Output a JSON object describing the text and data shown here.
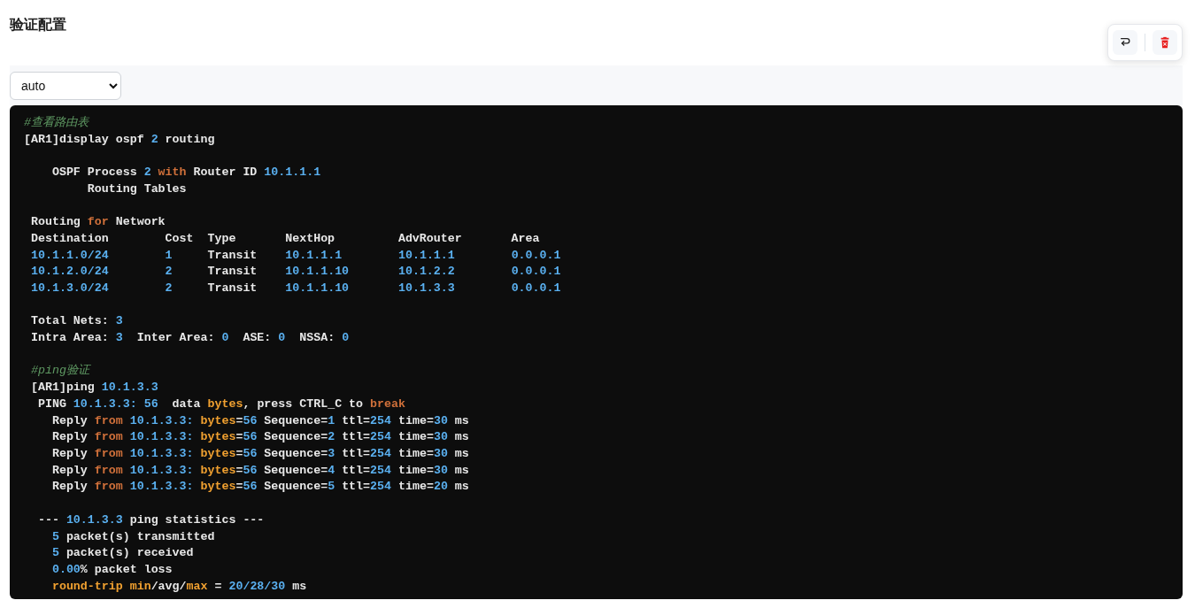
{
  "title": "验证配置",
  "toolbar": {
    "buttons": [
      {
        "kind": "wrap"
      },
      {
        "kind": "delete"
      }
    ]
  },
  "language_select": {
    "value": "auto"
  },
  "code_lines": [
    {
      "tokens": [
        {
          "text": "#查看路由表",
          "kind": "comment"
        }
      ]
    },
    {
      "tokens": [
        {
          "text": "[AR1]display ospf",
          "kind": "text"
        },
        {
          "text": " 2",
          "kind": "num"
        },
        {
          "text": " routing",
          "kind": "text"
        }
      ]
    },
    {
      "kind": "blank"
    },
    {
      "tokens": [
        {
          "text": "    OSPF Process",
          "kind": "text"
        },
        {
          "text": " 2",
          "kind": "num"
        },
        {
          "text": " with",
          "kind": "kw"
        },
        {
          "text": " Router ID",
          "kind": "text"
        },
        {
          "text": " 10.1.1.1",
          "kind": "num"
        }
      ]
    },
    {
      "tokens": [
        {
          "text": "         Routing Tables",
          "kind": "text"
        }
      ]
    },
    {
      "kind": "blank"
    },
    {
      "tokens": [
        {
          "text": " Routing",
          "kind": "text"
        },
        {
          "text": " for",
          "kind": "kw"
        },
        {
          "text": " Network",
          "kind": "text"
        }
      ]
    },
    {
      "tokens": [
        {
          "text": " Destination        Cost  Type       NextHop         AdvRouter       Area",
          "kind": "text"
        }
      ]
    },
    {
      "tokens": [
        {
          "text": " 10.1.1.0/24",
          "kind": "num"
        },
        {
          "text": "        1",
          "kind": "num"
        },
        {
          "text": "     Transit",
          "kind": "text"
        },
        {
          "text": "    10.1.1.1",
          "kind": "num"
        },
        {
          "text": "        10.1.1.1",
          "kind": "num"
        },
        {
          "text": "        0.0.0.1",
          "kind": "num"
        }
      ]
    },
    {
      "tokens": [
        {
          "text": " 10.1.2.0/24",
          "kind": "num"
        },
        {
          "text": "        2",
          "kind": "num"
        },
        {
          "text": "     Transit",
          "kind": "text"
        },
        {
          "text": "    10.1.1.10",
          "kind": "num"
        },
        {
          "text": "       10.1.2.2",
          "kind": "num"
        },
        {
          "text": "        0.0.0.1",
          "kind": "num"
        }
      ]
    },
    {
      "tokens": [
        {
          "text": " 10.1.3.0/24",
          "kind": "num"
        },
        {
          "text": "        2",
          "kind": "num"
        },
        {
          "text": "     Transit",
          "kind": "text"
        },
        {
          "text": "    10.1.1.10",
          "kind": "num"
        },
        {
          "text": "       10.1.3.3",
          "kind": "num"
        },
        {
          "text": "        0.0.0.1",
          "kind": "num"
        }
      ]
    },
    {
      "kind": "blank"
    },
    {
      "tokens": [
        {
          "text": " Total Nets:",
          "kind": "text"
        },
        {
          "text": " 3",
          "kind": "num"
        }
      ]
    },
    {
      "tokens": [
        {
          "text": " Intra Area:",
          "kind": "text"
        },
        {
          "text": " 3",
          "kind": "num"
        },
        {
          "text": "  Inter Area:",
          "kind": "text"
        },
        {
          "text": " 0",
          "kind": "num"
        },
        {
          "text": "  ASE:",
          "kind": "text"
        },
        {
          "text": " 0",
          "kind": "num"
        },
        {
          "text": "  NSSA:",
          "kind": "text"
        },
        {
          "text": " 0",
          "kind": "num"
        }
      ]
    },
    {
      "kind": "blank"
    },
    {
      "tokens": [
        {
          "text": " #ping验证",
          "kind": "comment"
        }
      ]
    },
    {
      "tokens": [
        {
          "text": " [AR1]ping",
          "kind": "text"
        },
        {
          "text": " 10.1.3.3",
          "kind": "num"
        }
      ]
    },
    {
      "tokens": [
        {
          "text": "  PING",
          "kind": "text"
        },
        {
          "text": " 10.1.3.3:",
          "kind": "num"
        },
        {
          "text": " 56",
          "kind": "num"
        },
        {
          "text": "  data",
          "kind": "text"
        },
        {
          "text": " bytes",
          "kind": "attr"
        },
        {
          "text": ", press CTRL_C to",
          "kind": "text"
        },
        {
          "text": " break",
          "kind": "kw"
        }
      ]
    },
    {
      "tokens": [
        {
          "text": "    Reply",
          "kind": "text"
        },
        {
          "text": " from",
          "kind": "kw"
        },
        {
          "text": " 10.1.3.3:",
          "kind": "num"
        },
        {
          "text": " bytes",
          "kind": "attr"
        },
        {
          "text": "=",
          "kind": "text"
        },
        {
          "text": "56",
          "kind": "num"
        },
        {
          "text": " Sequence=",
          "kind": "text"
        },
        {
          "text": "1",
          "kind": "num"
        },
        {
          "text": " ttl=",
          "kind": "text"
        },
        {
          "text": "254",
          "kind": "num"
        },
        {
          "text": " time=",
          "kind": "text"
        },
        {
          "text": "30",
          "kind": "num"
        },
        {
          "text": " ms",
          "kind": "text"
        }
      ]
    },
    {
      "tokens": [
        {
          "text": "    Reply",
          "kind": "text"
        },
        {
          "text": " from",
          "kind": "kw"
        },
        {
          "text": " 10.1.3.3:",
          "kind": "num"
        },
        {
          "text": " bytes",
          "kind": "attr"
        },
        {
          "text": "=",
          "kind": "text"
        },
        {
          "text": "56",
          "kind": "num"
        },
        {
          "text": " Sequence=",
          "kind": "text"
        },
        {
          "text": "2",
          "kind": "num"
        },
        {
          "text": " ttl=",
          "kind": "text"
        },
        {
          "text": "254",
          "kind": "num"
        },
        {
          "text": " time=",
          "kind": "text"
        },
        {
          "text": "30",
          "kind": "num"
        },
        {
          "text": " ms",
          "kind": "text"
        }
      ]
    },
    {
      "tokens": [
        {
          "text": "    Reply",
          "kind": "text"
        },
        {
          "text": " from",
          "kind": "kw"
        },
        {
          "text": " 10.1.3.3:",
          "kind": "num"
        },
        {
          "text": " bytes",
          "kind": "attr"
        },
        {
          "text": "=",
          "kind": "text"
        },
        {
          "text": "56",
          "kind": "num"
        },
        {
          "text": " Sequence=",
          "kind": "text"
        },
        {
          "text": "3",
          "kind": "num"
        },
        {
          "text": " ttl=",
          "kind": "text"
        },
        {
          "text": "254",
          "kind": "num"
        },
        {
          "text": " time=",
          "kind": "text"
        },
        {
          "text": "30",
          "kind": "num"
        },
        {
          "text": " ms",
          "kind": "text"
        }
      ]
    },
    {
      "tokens": [
        {
          "text": "    Reply",
          "kind": "text"
        },
        {
          "text": " from",
          "kind": "kw"
        },
        {
          "text": " 10.1.3.3:",
          "kind": "num"
        },
        {
          "text": " bytes",
          "kind": "attr"
        },
        {
          "text": "=",
          "kind": "text"
        },
        {
          "text": "56",
          "kind": "num"
        },
        {
          "text": " Sequence=",
          "kind": "text"
        },
        {
          "text": "4",
          "kind": "num"
        },
        {
          "text": " ttl=",
          "kind": "text"
        },
        {
          "text": "254",
          "kind": "num"
        },
        {
          "text": " time=",
          "kind": "text"
        },
        {
          "text": "30",
          "kind": "num"
        },
        {
          "text": " ms",
          "kind": "text"
        }
      ]
    },
    {
      "tokens": [
        {
          "text": "    Reply",
          "kind": "text"
        },
        {
          "text": " from",
          "kind": "kw"
        },
        {
          "text": " 10.1.3.3:",
          "kind": "num"
        },
        {
          "text": " bytes",
          "kind": "attr"
        },
        {
          "text": "=",
          "kind": "text"
        },
        {
          "text": "56",
          "kind": "num"
        },
        {
          "text": " Sequence=",
          "kind": "text"
        },
        {
          "text": "5",
          "kind": "num"
        },
        {
          "text": " ttl=",
          "kind": "text"
        },
        {
          "text": "254",
          "kind": "num"
        },
        {
          "text": " time=",
          "kind": "text"
        },
        {
          "text": "20",
          "kind": "num"
        },
        {
          "text": " ms",
          "kind": "text"
        }
      ]
    },
    {
      "kind": "blank"
    },
    {
      "tokens": [
        {
          "text": "  ---",
          "kind": "text"
        },
        {
          "text": " 10.1.3.3",
          "kind": "num"
        },
        {
          "text": " ping statistics ---",
          "kind": "text"
        }
      ]
    },
    {
      "tokens": [
        {
          "text": "    5",
          "kind": "num"
        },
        {
          "text": " packet(s) transmitted",
          "kind": "text"
        }
      ]
    },
    {
      "tokens": [
        {
          "text": "    5",
          "kind": "num"
        },
        {
          "text": " packet(s) received",
          "kind": "text"
        }
      ]
    },
    {
      "tokens": [
        {
          "text": "    0.00",
          "kind": "num"
        },
        {
          "text": "% packet loss",
          "kind": "text"
        }
      ]
    },
    {
      "tokens": [
        {
          "text": "    round-trip",
          "kind": "attr"
        },
        {
          "text": " min",
          "kind": "attr"
        },
        {
          "text": "/avg/",
          "kind": "text"
        },
        {
          "text": "max",
          "kind": "attr"
        },
        {
          "text": " =",
          "kind": "text"
        },
        {
          "text": " 20/28/30",
          "kind": "num"
        },
        {
          "text": " ms",
          "kind": "text"
        }
      ]
    }
  ]
}
